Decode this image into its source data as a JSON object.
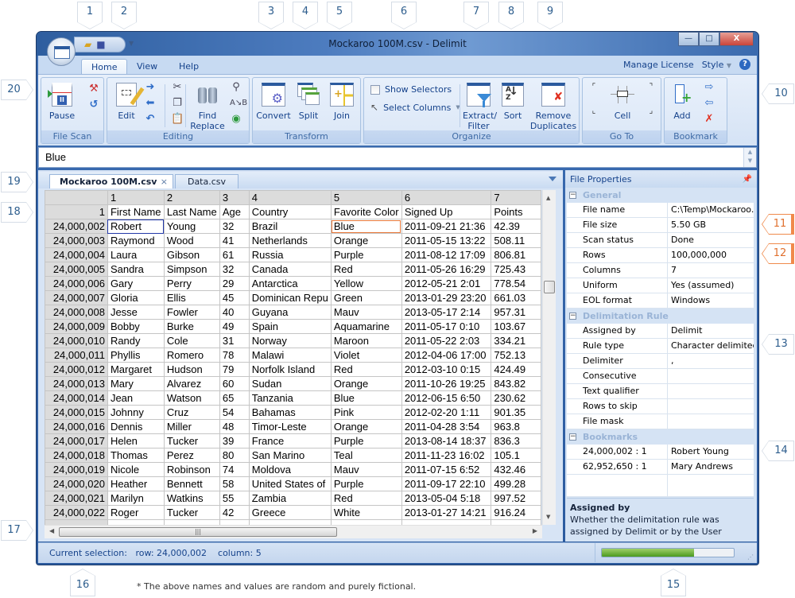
{
  "callouts": {
    "top": [
      "1",
      "2",
      "3",
      "4",
      "5",
      "6",
      "7",
      "8",
      "9"
    ],
    "right": [
      "10",
      "11",
      "12",
      "13",
      "14"
    ],
    "bottom": [
      "15",
      "16"
    ],
    "left": [
      "17",
      "18",
      "19",
      "20"
    ]
  },
  "window": {
    "title": "Mockaroo 100M.csv - Delimit",
    "controls": {
      "minimize": "—",
      "maximize": "□",
      "close": "X"
    }
  },
  "ribbon": {
    "tabs": [
      {
        "label": "Home",
        "active": true
      },
      {
        "label": "View",
        "active": false
      },
      {
        "label": "Help",
        "active": false
      }
    ],
    "links": {
      "manage_license": "Manage License",
      "style": "Style",
      "help": "?"
    },
    "groups": {
      "file_scan": {
        "label": "File Scan",
        "pause": "Pause"
      },
      "editing": {
        "label": "Editing",
        "edit": "Edit",
        "find_replace_1": "Find",
        "find_replace_2": "Replace"
      },
      "transform": {
        "label": "Transform",
        "convert": "Convert",
        "split": "Split",
        "join": "Join"
      },
      "organize": {
        "label": "Organize",
        "show_selectors": "Show Selectors",
        "show_selectors_checked": false,
        "select_columns": "Select Columns",
        "extract_1": "Extract/",
        "extract_2": "Filter",
        "sort": "Sort",
        "remove_1": "Remove",
        "remove_2": "Duplicates"
      },
      "goto": {
        "label": "Go To",
        "cell": "Cell"
      },
      "bookmark": {
        "label": "Bookmark",
        "add": "Add"
      }
    }
  },
  "formula_bar": {
    "value": "Blue"
  },
  "doc_tabs": [
    {
      "label": "Mockaroo 100M.csv",
      "active": true,
      "close": "×"
    },
    {
      "label": "Data.csv",
      "active": false
    }
  ],
  "grid": {
    "column_numbers": [
      "1",
      "2",
      "3",
      "4",
      "5",
      "6",
      "7"
    ],
    "header_row_number": "1",
    "headers": [
      "First Name",
      "Last Name",
      "Age",
      "Country",
      "Favorite Color",
      "Signed Up",
      "Points"
    ],
    "rows": [
      {
        "n": "24,000,002",
        "c": [
          "Robert",
          "Young",
          "32",
          "Brazil",
          "Blue",
          "2011-09-21 21:36",
          "42.39"
        ]
      },
      {
        "n": "24,000,003",
        "c": [
          "Raymond",
          "Wood",
          "41",
          "Netherlands",
          "Orange",
          "2011-05-15 13:22",
          "508.11"
        ]
      },
      {
        "n": "24,000,004",
        "c": [
          "Laura",
          "Gibson",
          "61",
          "Russia",
          "Purple",
          "2011-08-12 17:09",
          "806.81"
        ]
      },
      {
        "n": "24,000,005",
        "c": [
          "Sandra",
          "Simpson",
          "32",
          "Canada",
          "Red",
          "2011-05-26 16:29",
          "725.43"
        ]
      },
      {
        "n": "24,000,006",
        "c": [
          "Gary",
          "Perry",
          "29",
          "Antarctica",
          "Yellow",
          "2012-05-21 2:01",
          "778.54"
        ]
      },
      {
        "n": "24,000,007",
        "c": [
          "Gloria",
          "Ellis",
          "45",
          "Dominican Repu",
          "Green",
          "2013-01-29 23:20",
          "661.03"
        ]
      },
      {
        "n": "24,000,008",
        "c": [
          "Jesse",
          "Fowler",
          "40",
          "Guyana",
          "Mauv",
          "2013-05-17 2:14",
          "957.31"
        ]
      },
      {
        "n": "24,000,009",
        "c": [
          "Bobby",
          "Burke",
          "49",
          "Spain",
          "Aquamarine",
          "2011-05-17 0:10",
          "103.67"
        ]
      },
      {
        "n": "24,000,010",
        "c": [
          "Randy",
          "Cole",
          "31",
          "Norway",
          "Maroon",
          "2011-05-22 2:03",
          "334.21"
        ]
      },
      {
        "n": "24,000,011",
        "c": [
          "Phyllis",
          "Romero",
          "78",
          "Malawi",
          "Violet",
          "2012-04-06 17:00",
          "752.13"
        ]
      },
      {
        "n": "24,000,012",
        "c": [
          "Margaret",
          "Hudson",
          "79",
          "Norfolk Island",
          "Red",
          "2012-03-10 0:15",
          "424.49"
        ]
      },
      {
        "n": "24,000,013",
        "c": [
          "Mary",
          "Alvarez",
          "60",
          "Sudan",
          "Orange",
          "2011-10-26 19:25",
          "843.82"
        ]
      },
      {
        "n": "24,000,014",
        "c": [
          "Jean",
          "Watson",
          "65",
          "Tanzania",
          "Blue",
          "2012-06-15 6:50",
          "230.62"
        ]
      },
      {
        "n": "24,000,015",
        "c": [
          "Johnny",
          "Cruz",
          "54",
          "Bahamas",
          "Pink",
          "2012-02-20 1:11",
          "901.35"
        ]
      },
      {
        "n": "24,000,016",
        "c": [
          "Dennis",
          "Miller",
          "48",
          "Timor-Leste",
          "Orange",
          "2011-04-28 3:54",
          "963.8"
        ]
      },
      {
        "n": "24,000,017",
        "c": [
          "Helen",
          "Tucker",
          "39",
          "France",
          "Purple",
          "2013-08-14 18:37",
          "836.3"
        ]
      },
      {
        "n": "24,000,018",
        "c": [
          "Thomas",
          "Perez",
          "80",
          "San Marino",
          "Teal",
          "2011-11-23 16:02",
          "105.1"
        ]
      },
      {
        "n": "24,000,019",
        "c": [
          "Nicole",
          "Robinson",
          "74",
          "Moldova",
          "Mauv",
          "2011-07-15 6:52",
          "432.46"
        ]
      },
      {
        "n": "24,000,020",
        "c": [
          "Heather",
          "Bennett",
          "58",
          "United States of",
          "Purple",
          "2011-09-17 22:10",
          "499.28"
        ]
      },
      {
        "n": "24,000,021",
        "c": [
          "Marilyn",
          "Watkins",
          "55",
          "Zambia",
          "Red",
          "2013-05-04 5:18",
          "997.52"
        ]
      },
      {
        "n": "24,000,022",
        "c": [
          "Roger",
          "Tucker",
          "42",
          "Greece",
          "White",
          "2013-01-27 14:21",
          "916.24"
        ]
      }
    ]
  },
  "properties": {
    "title": "File Properties",
    "pin": "ᵖ",
    "categories": [
      {
        "name": "General",
        "items": [
          {
            "k": "File name",
            "v": "C:\\Temp\\Mockaroo..."
          },
          {
            "k": "File size",
            "v": "5.50 GB"
          },
          {
            "k": "Scan status",
            "v": "Done"
          },
          {
            "k": "Rows",
            "v": "100,000,000"
          },
          {
            "k": "Columns",
            "v": "7"
          },
          {
            "k": "Uniform",
            "v": "Yes (assumed)"
          },
          {
            "k": "EOL format",
            "v": "Windows"
          }
        ]
      },
      {
        "name": "Delimitation Rule",
        "items": [
          {
            "k": "Assigned by",
            "v": "Delimit"
          },
          {
            "k": "Rule type",
            "v": "Character delimited"
          },
          {
            "k": "Delimiter",
            "v": ","
          },
          {
            "k": "Consecutive",
            "v": ""
          },
          {
            "k": "Text qualifier",
            "v": ""
          },
          {
            "k": "Rows to skip",
            "v": ""
          },
          {
            "k": "File mask",
            "v": ""
          }
        ]
      },
      {
        "name": "Bookmarks",
        "items": [
          {
            "k": "24,000,002 : 1",
            "v": "Robert Young"
          },
          {
            "k": "62,952,650 : 1",
            "v": "Mary Andrews"
          }
        ]
      }
    ],
    "description": {
      "title": "Assigned by",
      "text": "Whether the delimitation rule was assigned by Delimit or by the User"
    }
  },
  "status": {
    "text": "Current selection:   row: 24,000,002    column: 5",
    "progress_percent": 70
  },
  "footnote": "* The above names and values are random and purely fictional."
}
